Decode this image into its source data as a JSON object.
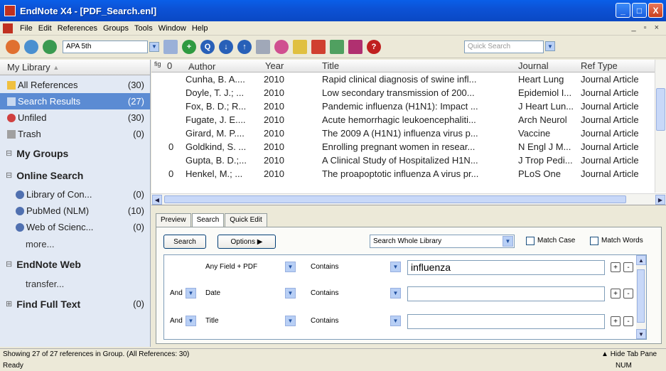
{
  "window": {
    "title": "EndNote X4 - [PDF_Search.enl]",
    "controls": [
      "_",
      "□",
      "X"
    ]
  },
  "menu": [
    "File",
    "Edit",
    "References",
    "Groups",
    "Tools",
    "Window",
    "Help"
  ],
  "toolbar": {
    "style": "APA 5th",
    "quick_search_placeholder": "Quick Search"
  },
  "library": {
    "header": "My Library",
    "items": [
      {
        "label": "All References",
        "count": "(30)"
      },
      {
        "label": "Search Results",
        "count": "(27)"
      },
      {
        "label": "Unfiled",
        "count": "(30)"
      },
      {
        "label": "Trash",
        "count": "(0)"
      }
    ],
    "groups": {
      "my_groups": "My Groups",
      "online_search": "Online Search",
      "online": [
        {
          "label": "Library of Con...",
          "count": "(0)"
        },
        {
          "label": "PubMed (NLM)",
          "count": "(10)"
        },
        {
          "label": "Web of Scienc...",
          "count": "(0)"
        }
      ],
      "more": "more...",
      "endnote_web": "EndNote Web",
      "transfer": "transfer...",
      "find_full_text": "Find Full Text",
      "find_full_text_count": "(0)"
    }
  },
  "columns": {
    "author": "Author",
    "year": "Year",
    "title": "Title",
    "journal": "Journal",
    "ref_type": "Ref Type"
  },
  "references": [
    {
      "attach": "",
      "author": "Cunha, B. A....",
      "year": "2010",
      "title": "Rapid clinical diagnosis of swine infl...",
      "journal": "Heart Lung",
      "type": "Journal Article"
    },
    {
      "attach": "",
      "author": "Doyle, T. J.; ...",
      "year": "2010",
      "title": "Low secondary transmission of 200...",
      "journal": "Epidemiol I...",
      "type": "Journal Article"
    },
    {
      "attach": "",
      "author": "Fox, B. D.; R...",
      "year": "2010",
      "title": "Pandemic influenza (H1N1): Impact ...",
      "journal": "J Heart Lun...",
      "type": "Journal Article"
    },
    {
      "attach": "",
      "author": "Fugate, J. E....",
      "year": "2010",
      "title": "Acute hemorrhagic leukoencephaliti...",
      "journal": "Arch Neurol",
      "type": "Journal Article"
    },
    {
      "attach": "",
      "author": "Girard, M. P....",
      "year": "2010",
      "title": "The 2009 A (H1N1) influenza virus p...",
      "journal": "Vaccine",
      "type": "Journal Article"
    },
    {
      "attach": "0",
      "author": "Goldkind, S. ...",
      "year": "2010",
      "title": "Enrolling pregnant women in resear...",
      "journal": "N Engl J M...",
      "type": "Journal Article"
    },
    {
      "attach": "",
      "author": "Gupta, B. D.;...",
      "year": "2010",
      "title": "A Clinical Study of Hospitalized H1N...",
      "journal": "J Trop Pedi...",
      "type": "Journal Article"
    },
    {
      "attach": "0",
      "author": "Henkel, M.; ...",
      "year": "2010",
      "title": "The proapoptotic influenza A virus pr...",
      "journal": "PLoS One",
      "type": "Journal Article"
    }
  ],
  "tabs": [
    "Preview",
    "Search",
    "Quick Edit"
  ],
  "search": {
    "search_btn": "Search",
    "options_btn": "Options",
    "scope": "Search Whole Library",
    "match_case": "Match Case",
    "match_words": "Match Words",
    "rows": [
      {
        "bool": "",
        "field": "Any Field + PDF",
        "op": "Contains",
        "value": "influenza"
      },
      {
        "bool": "And",
        "field": "Date",
        "op": "Contains",
        "value": ""
      },
      {
        "bool": "And",
        "field": "Title",
        "op": "Contains",
        "value": ""
      }
    ]
  },
  "status": {
    "showing": "Showing 27 of 27 references in Group. (All References: 30)",
    "hide_tab": "Hide Tab Pane",
    "ready": "Ready",
    "num": "NUM"
  }
}
